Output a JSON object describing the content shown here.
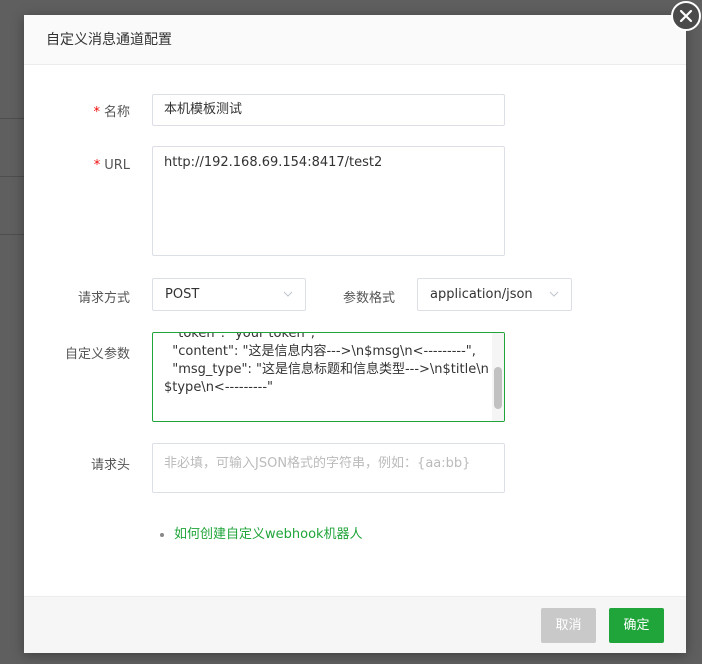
{
  "dialog": {
    "title": "自定义消息通道配置"
  },
  "form": {
    "name": {
      "label": "名称",
      "required_mark": "*",
      "value": "本机模板测试"
    },
    "url": {
      "label": "URL",
      "required_mark": "*",
      "value": "http://192.168.69.154:8417/test2"
    },
    "method": {
      "label": "请求方式",
      "value": "POST"
    },
    "format": {
      "label": "参数格式",
      "value": "application/json"
    },
    "params": {
      "label": "自定义参数",
      "value": "  \"token\": \"your token\",\n  \"content\": \"这是信息内容--->\\n$msg\\n<---------\",\n  \"msg_type\": \"这是信息标题和信息类型--->\\n$title\\n$type\\n<---------\""
    },
    "headers": {
      "label": "请求头",
      "placeholder": "非必填，可输入JSON格式的字符串，例如：{aa:bb}"
    }
  },
  "help_link": "如何创建自定义webhook机器人",
  "footer": {
    "cancel_label": "取消",
    "ok_label": "确定"
  },
  "colors": {
    "accent": "#20a53a",
    "required": "#ef0808",
    "cancel_bg": "#c9c9c9"
  }
}
